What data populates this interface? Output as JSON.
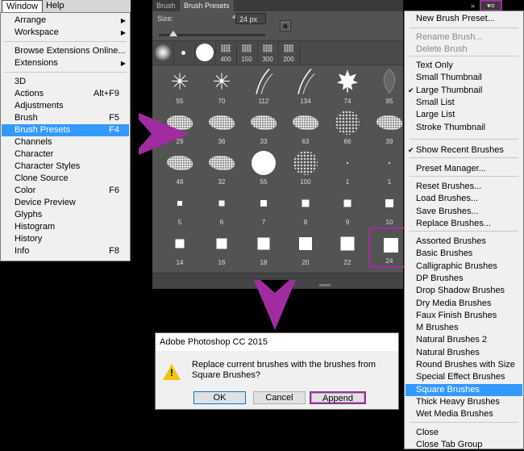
{
  "menubar": {
    "window": "Window",
    "help": "Help"
  },
  "window_menu": {
    "groups": [
      [
        {
          "label": "Arrange",
          "sub": true
        },
        {
          "label": "Workspace",
          "sub": true
        }
      ],
      [
        {
          "label": "Browse Extensions Online..."
        },
        {
          "label": "Extensions",
          "sub": true
        }
      ],
      [
        {
          "label": "3D"
        },
        {
          "label": "Actions",
          "shortcut": "Alt+F9"
        },
        {
          "label": "Adjustments"
        },
        {
          "label": "Brush",
          "shortcut": "F5"
        },
        {
          "label": "Brush Presets",
          "shortcut": "F4",
          "highlight": true
        },
        {
          "label": "Channels"
        },
        {
          "label": "Character"
        },
        {
          "label": "Character Styles"
        },
        {
          "label": "Clone Source"
        },
        {
          "label": "Color",
          "shortcut": "F6"
        },
        {
          "label": "Device Preview"
        },
        {
          "label": "Glyphs"
        },
        {
          "label": "Histogram"
        },
        {
          "label": "History"
        },
        {
          "label": "Info",
          "shortcut": "F8"
        }
      ]
    ]
  },
  "panel": {
    "tabs": [
      "Brush",
      "Brush Presets"
    ],
    "collapse_glyph": "»",
    "menu_glyph": "▾≡",
    "size_label": "Size:",
    "size_value": "24 px",
    "recent": [
      {
        "kind": "soft"
      },
      {
        "kind": "dot"
      },
      {
        "kind": "big"
      },
      {
        "num": "400"
      },
      {
        "num": "150"
      },
      {
        "num": "300"
      },
      {
        "num": "200"
      }
    ],
    "brushes": [
      {
        "num": "55",
        "kind": "star"
      },
      {
        "num": "70",
        "kind": "star"
      },
      {
        "num": "112",
        "kind": "grass"
      },
      {
        "num": "134",
        "kind": "grass"
      },
      {
        "num": "74",
        "kind": "leaf"
      },
      {
        "num": "95",
        "kind": "leaf2"
      },
      {
        "num": "29",
        "kind": "splat"
      },
      {
        "num": "36",
        "kind": "splat"
      },
      {
        "num": "33",
        "kind": "splat"
      },
      {
        "num": "63",
        "kind": "splat"
      },
      {
        "num": "66",
        "kind": "noise"
      },
      {
        "num": "39",
        "kind": "splat"
      },
      {
        "num": "48",
        "kind": "splat"
      },
      {
        "num": "32",
        "kind": "splat"
      },
      {
        "num": "55",
        "kind": "round"
      },
      {
        "num": "100",
        "kind": "noise"
      },
      {
        "num": "1",
        "kind": "tiny"
      },
      {
        "num": "1",
        "kind": "tiny"
      },
      {
        "num": "5",
        "kind": "sq"
      },
      {
        "num": "6",
        "kind": "sq"
      },
      {
        "num": "7",
        "kind": "sq"
      },
      {
        "num": "8",
        "kind": "sq"
      },
      {
        "num": "9",
        "kind": "sq"
      },
      {
        "num": "10",
        "kind": "sq"
      },
      {
        "num": "14",
        "kind": "sq"
      },
      {
        "num": "16",
        "kind": "sq"
      },
      {
        "num": "18",
        "kind": "sq"
      },
      {
        "num": "20",
        "kind": "sq"
      },
      {
        "num": "22",
        "kind": "sq"
      },
      {
        "num": "24",
        "kind": "sq",
        "selected": true
      }
    ]
  },
  "flyout": {
    "groups": [
      [
        {
          "label": "New Brush Preset..."
        }
      ],
      [
        {
          "label": "Rename Brush...",
          "disabled": true
        },
        {
          "label": "Delete Brush",
          "disabled": true
        }
      ],
      [
        {
          "label": "Text Only"
        },
        {
          "label": "Small Thumbnail"
        },
        {
          "label": "Large Thumbnail",
          "checked": true
        },
        {
          "label": "Small List"
        },
        {
          "label": "Large List"
        },
        {
          "label": "Stroke Thumbnail"
        }
      ],
      [
        {
          "label": "Show Recent Brushes",
          "checked": true
        }
      ],
      [
        {
          "label": "Preset Manager..."
        }
      ],
      [
        {
          "label": "Reset Brushes..."
        },
        {
          "label": "Load Brushes..."
        },
        {
          "label": "Save Brushes..."
        },
        {
          "label": "Replace Brushes..."
        }
      ],
      [
        {
          "label": "Assorted Brushes"
        },
        {
          "label": "Basic Brushes"
        },
        {
          "label": "Calligraphic Brushes"
        },
        {
          "label": "DP Brushes"
        },
        {
          "label": "Drop Shadow Brushes"
        },
        {
          "label": "Dry Media Brushes"
        },
        {
          "label": "Faux Finish Brushes"
        },
        {
          "label": "M Brushes"
        },
        {
          "label": "Natural Brushes 2"
        },
        {
          "label": "Natural Brushes"
        },
        {
          "label": "Round Brushes with Size"
        },
        {
          "label": "Special Effect Brushes"
        },
        {
          "label": "Square Brushes",
          "highlight": true
        },
        {
          "label": "Thick Heavy Brushes"
        },
        {
          "label": "Wet Media Brushes"
        }
      ],
      [
        {
          "label": "Close"
        },
        {
          "label": "Close Tab Group"
        }
      ]
    ]
  },
  "dialog": {
    "title": "Adobe Photoshop CC 2015",
    "message": "Replace current brushes with the brushes from Square Brushes?",
    "ok": "OK",
    "cancel": "Cancel",
    "append": "Append"
  },
  "colors": {
    "highlight": "#3399ff",
    "annotation": "#a12ca0",
    "panel": "#535353"
  }
}
